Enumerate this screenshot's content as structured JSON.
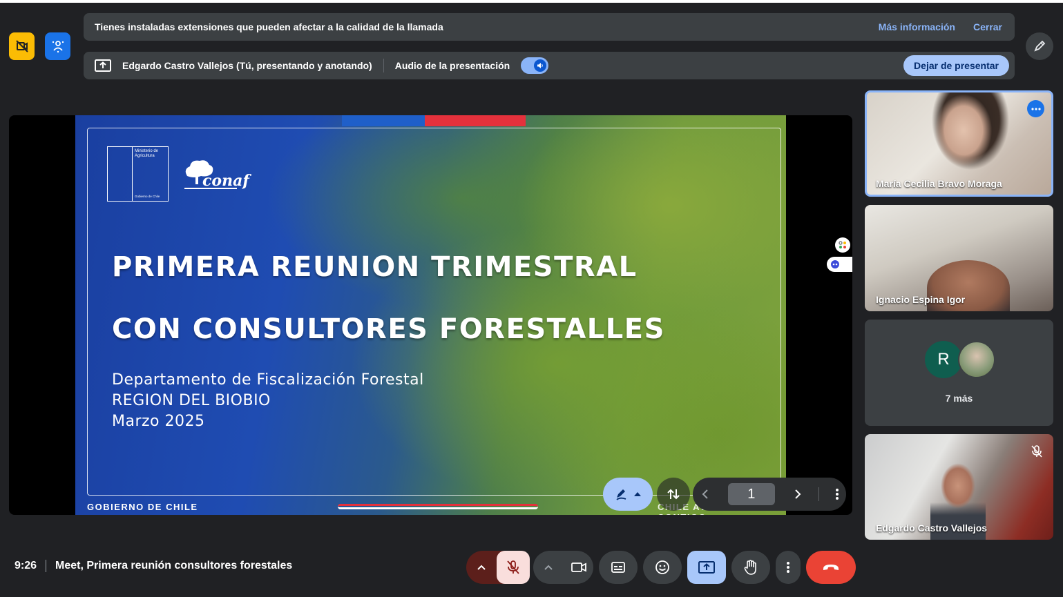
{
  "top_left_buttons": {
    "no_video_icon_color": "#fbbc04",
    "effects_icon_color": "#1a73e8"
  },
  "extension_banner": {
    "message": "Tienes instaladas extensiones que pueden afectar a la calidad de la llamada",
    "more_info": "Más información",
    "close": "Cerrar"
  },
  "presenting_bar": {
    "presenter": "Edgardo Castro Vallejos (Tú, presentando y anotando)",
    "audio_label": "Audio de la presentación",
    "audio_on": true,
    "stop_button": "Dejar de presentar"
  },
  "slide": {
    "ministry": "Ministerio de Agricultura",
    "ministry_footer": "Gobierno de Chile",
    "logo_text": "conaf",
    "title_line1": "PRIMERA REUNION TRIMESTRAL",
    "title_line2": "CON CONSULTORES FORESTALLES",
    "subtitle_line1": "Departamento de Fiscalización Forestal",
    "subtitle_line2": "REGION DEL BIOBIO",
    "subtitle_line3": "Marzo 2025",
    "footer_left": "GOBIERNO DE CHILE",
    "footer_right": "CHILE AVANZA CONTIGO"
  },
  "annotation_toolbar": {
    "current_page": "1"
  },
  "participants": [
    {
      "name": "María Cecilia Bravo Moraga",
      "active_speaker": true
    },
    {
      "name": "Ignacio Espina Igor"
    },
    {
      "initial": "R",
      "more_label": "7 más"
    },
    {
      "name": "Edgardo Castro Vallejos",
      "muted": true
    }
  ],
  "meeting": {
    "time": "9:26",
    "title": "Meet, Primera reunión consultores forestales"
  },
  "colors": {
    "background": "#202124",
    "accent_blue": "#8ab4f8",
    "mic_muted_bg": "#f9dedc",
    "end_call": "#ea4335",
    "present_active": "#a8c7fa"
  }
}
